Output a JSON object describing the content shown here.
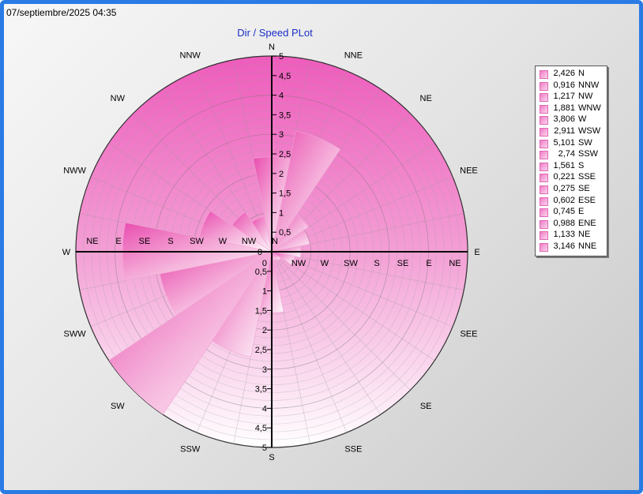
{
  "header": {
    "timestamp": "07/septiembre/2025 04:35"
  },
  "colors": {
    "frame_border": "#2a7be4",
    "rose_fill": "#f07cc6",
    "title": "#1a2fc8"
  },
  "chart_data": {
    "type": "polar-area",
    "title": "Dir / Speed PLot",
    "directions": [
      "N",
      "NNE",
      "NE",
      "ENE",
      "E",
      "ESE",
      "SE",
      "SSE",
      "S",
      "SSW",
      "SW",
      "WSW",
      "W",
      "WNW",
      "NW",
      "NNW"
    ],
    "values": [
      2.426,
      3.146,
      1.133,
      0.988,
      0.745,
      0.602,
      0.275,
      0.221,
      1.561,
      2.74,
      5.101,
      2.911,
      3.806,
      1.881,
      1.217,
      0.916
    ],
    "compass_labels": [
      "N",
      "NNE",
      "NE",
      "NEE",
      "E",
      "SEE",
      "SE",
      "SSE",
      "S",
      "SSW",
      "SW",
      "SWW",
      "W",
      "NWW",
      "NW",
      "NNW"
    ],
    "radial_axis": {
      "range": [
        0,
        5
      ],
      "ticks": [
        "0",
        "0,5",
        "1",
        "1,5",
        "2",
        "2,5",
        "3",
        "3,5",
        "4",
        "4,5",
        "5"
      ],
      "tick_values": [
        0,
        0.5,
        1,
        1.5,
        2,
        2.5,
        3,
        3.5,
        4,
        4.5,
        5
      ]
    },
    "axis_direction_labels": {
      "east": [
        "NW",
        "W",
        "SW",
        "S",
        "SE",
        "E",
        "NE"
      ],
      "west": [
        "NE",
        "E",
        "SE",
        "S",
        "SW",
        "W",
        "NW",
        "N"
      ]
    },
    "legend": {
      "position": "right",
      "items": [
        {
          "value": "2,426",
          "dir": "N"
        },
        {
          "value": "0,916",
          "dir": "NNW"
        },
        {
          "value": "1,217",
          "dir": "NW"
        },
        {
          "value": "1,881",
          "dir": "WNW"
        },
        {
          "value": "3,806",
          "dir": "W"
        },
        {
          "value": "2,911",
          "dir": "WSW"
        },
        {
          "value": "5,101",
          "dir": "SW"
        },
        {
          "value": "2,74",
          "dir": "SSW"
        },
        {
          "value": "1,561",
          "dir": "S"
        },
        {
          "value": "0,221",
          "dir": "SSE"
        },
        {
          "value": "0,275",
          "dir": "SE"
        },
        {
          "value": "0,602",
          "dir": "ESE"
        },
        {
          "value": "0,745",
          "dir": "E"
        },
        {
          "value": "0,988",
          "dir": "ENE"
        },
        {
          "value": "1,133",
          "dir": "NE"
        },
        {
          "value": "3,146",
          "dir": "NNE"
        }
      ]
    }
  }
}
